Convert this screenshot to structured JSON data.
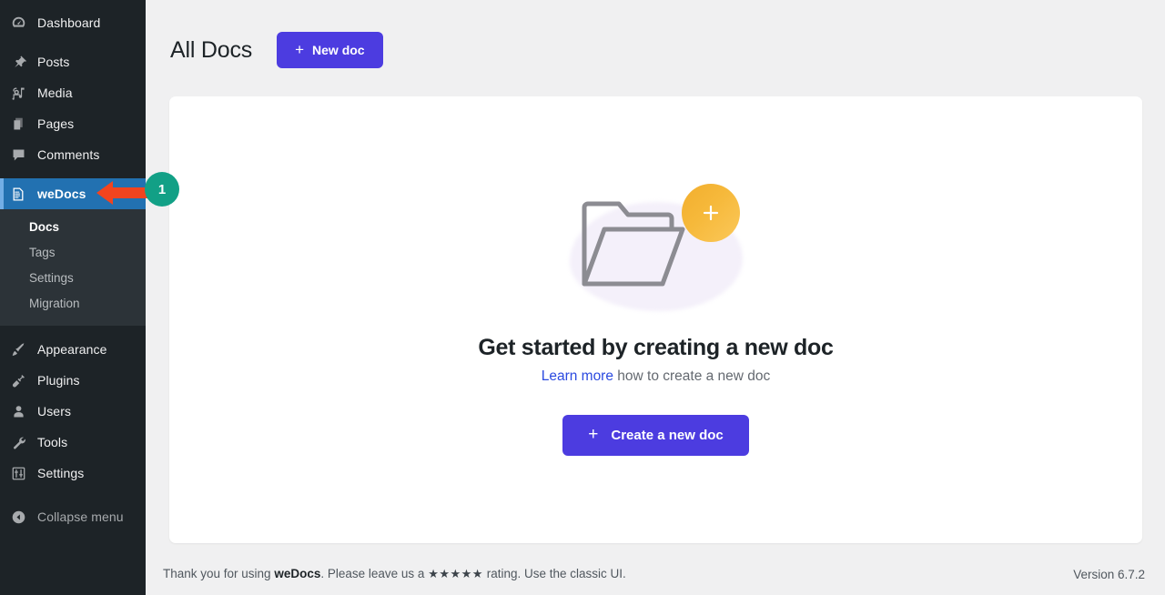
{
  "sidebar": {
    "items": [
      {
        "label": "Dashboard",
        "icon": "dashboard-icon",
        "active": false
      },
      {
        "label": "Posts",
        "icon": "pin-icon",
        "active": false
      },
      {
        "label": "Media",
        "icon": "media-icon",
        "active": false
      },
      {
        "label": "Pages",
        "icon": "pages-icon",
        "active": false
      },
      {
        "label": "Comments",
        "icon": "comment-icon",
        "active": false
      },
      {
        "label": "weDocs",
        "icon": "document-icon",
        "active": true
      },
      {
        "label": "Appearance",
        "icon": "paintbrush-icon",
        "active": false
      },
      {
        "label": "Plugins",
        "icon": "plug-icon",
        "active": false
      },
      {
        "label": "Users",
        "icon": "user-icon",
        "active": false
      },
      {
        "label": "Tools",
        "icon": "wrench-icon",
        "active": false
      },
      {
        "label": "Settings",
        "icon": "sliders-icon",
        "active": false
      }
    ],
    "submenu": [
      {
        "label": "Docs",
        "current": true
      },
      {
        "label": "Tags",
        "current": false
      },
      {
        "label": "Settings",
        "current": false
      },
      {
        "label": "Migration",
        "current": false
      }
    ],
    "collapse_label": "Collapse menu",
    "collapse_icon": "collapse-arrow-icon",
    "active_color": "#2271b1",
    "background": "#1d2327"
  },
  "header": {
    "title": "All Docs",
    "new_doc_label": "New doc",
    "plus_glyph": "+"
  },
  "empty_state": {
    "title": "Get started by creating a new doc",
    "subtitle_link": "Learn more",
    "subtitle_rest": " how to create a new doc",
    "cta_label": "Create a new doc",
    "cta_plus": "+",
    "illustration": "folder-with-plus-illustration",
    "accent_color": "#4c3ce0",
    "link_color": "#2b4ae0",
    "badge_color": "#f6b93b"
  },
  "footer": {
    "thanks_prefix": "Thank you for using ",
    "product": "weDocs",
    "thanks_mid": ". Please leave us a ",
    "stars": "★★★★★",
    "thanks_suffix": " rating. Use the classic UI.",
    "version": "Version 6.7.2"
  },
  "annotation": {
    "step_number": "1",
    "arrow_color": "#f1441f",
    "badge_color": "#12a086"
  }
}
